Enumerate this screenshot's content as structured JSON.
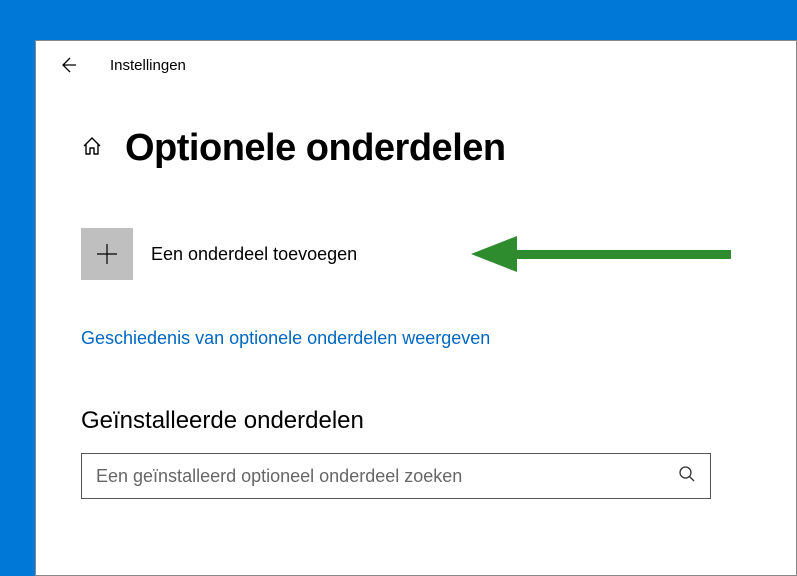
{
  "titlebar": {
    "app_title": "Instellingen"
  },
  "header": {
    "page_title": "Optionele onderdelen"
  },
  "content": {
    "add_label": "Een onderdeel toevoegen",
    "history_link": "Geschiedenis van optionele onderdelen weergeven",
    "installed_section_title": "Geïnstalleerde onderdelen",
    "search_placeholder": "Een geïnstalleerd optioneel onderdeel zoeken"
  },
  "colors": {
    "accent": "#0078d7",
    "link": "#0067c0",
    "arrow": "#2e8b2e"
  }
}
